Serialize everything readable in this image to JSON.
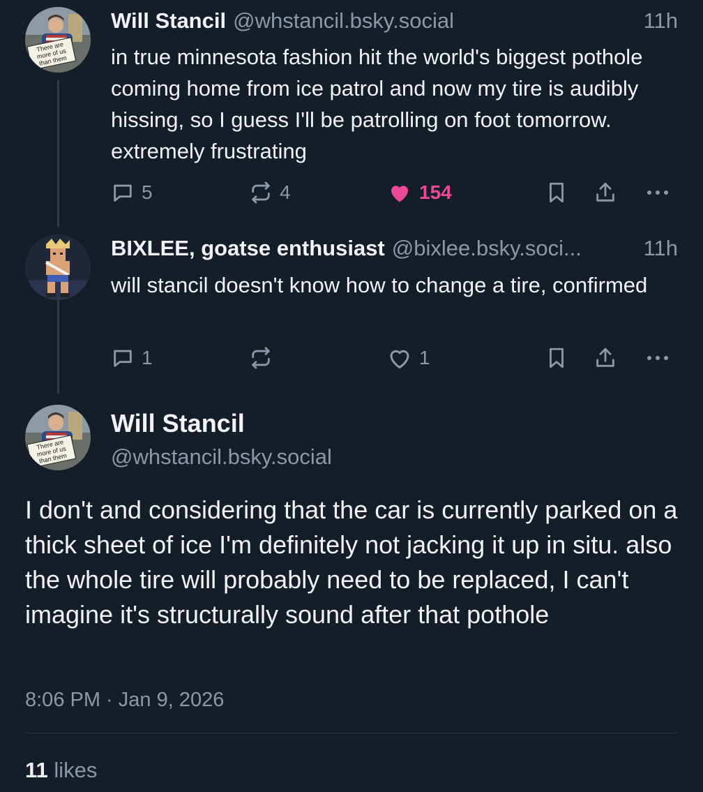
{
  "posts": [
    {
      "name": "Will Stancil",
      "handle": "@whstancil.bsky.social",
      "time": "11h",
      "text": "in true minnesota fashion hit the world's biggest pothole coming home from ice patrol and now my tire is audibly hissing, so I guess I'll be patrolling on foot tomorrow. extremely frustrating",
      "avatar_sign": [
        "There are",
        "more of us",
        "than them"
      ],
      "replies": "5",
      "reposts": "4",
      "likes": "154",
      "liked": true
    },
    {
      "name": "BIXLEE, goatse enthusiast",
      "handle": "@bixlee.bsky.soci...",
      "time": "11h",
      "text": "will stancil doesn't know how to change a tire, confirmed",
      "replies": "1",
      "reposts": "",
      "likes": "1",
      "liked": false
    }
  ],
  "focused": {
    "name": "Will Stancil",
    "handle": "@whstancil.bsky.social",
    "avatar_sign": [
      "There are",
      "more of us",
      "than them"
    ],
    "text": "I don't and considering that the car is currently parked on a thick sheet of ice I'm definitely not jacking it up in situ. also the whole tire will probably need to be replaced, I can't imagine it's structurally sound after that pothole",
    "timestamp": "8:06 PM · Jan 9, 2026",
    "likes_count": "11",
    "likes_label": "likes"
  },
  "colors": {
    "background": "#151d28",
    "text": "#f1f3f5",
    "muted": "#8b98a9",
    "like": "#ec4899",
    "thread_line": "#2f3b4b"
  },
  "icons": [
    "reply-icon",
    "repost-icon",
    "heart-icon",
    "bookmark-icon",
    "share-icon",
    "more-icon"
  ]
}
